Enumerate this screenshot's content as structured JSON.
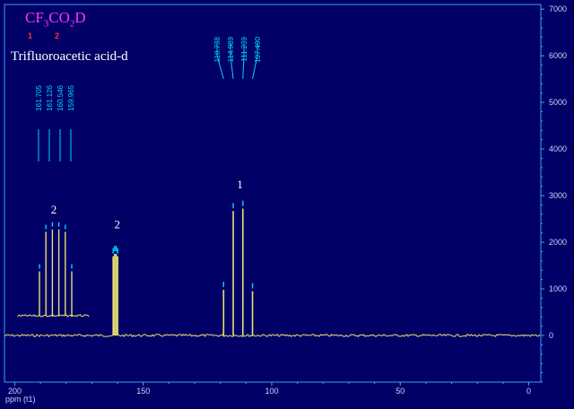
{
  "title": {
    "formula_parts": [
      "CF",
      "3",
      "CO",
      "2",
      "D"
    ],
    "atom_labels": [
      "1",
      "2"
    ],
    "compound_name": "Trifluoroacetic acid-d"
  },
  "colors": {
    "background": "#000066",
    "plot_border": "#3aa0ff",
    "tick_text": "#c8d2ff",
    "spectrum": "#e8e070",
    "formula": "#ff33ff",
    "atom_label": "#ff3333",
    "annotation": "#00d4ff",
    "label_text": "#ffffff"
  },
  "chart_data": {
    "type": "line",
    "xlabel": "ppm (t1)",
    "x_reversed": true,
    "xlim": [
      204,
      -4.7
    ],
    "ylim": [
      -1000,
      7100
    ],
    "x_ticks": [
      200,
      150,
      100,
      50,
      0
    ],
    "y_ticks": [
      0,
      1000,
      2000,
      3000,
      4000,
      5000,
      6000,
      7000
    ],
    "peaks": [
      {
        "ppm": 161.705,
        "height": 1700
      },
      {
        "ppm": 161.126,
        "height": 1750
      },
      {
        "ppm": 160.546,
        "height": 1750
      },
      {
        "ppm": 159.965,
        "height": 1700
      },
      {
        "ppm": 118.738,
        "height": 980
      },
      {
        "ppm": 114.989,
        "height": 2670
      },
      {
        "ppm": 111.239,
        "height": 2720
      },
      {
        "ppm": 107.49,
        "height": 950
      }
    ],
    "peak_groups": [
      {
        "label": "2",
        "ppm": 160.8,
        "height": 2400
      },
      {
        "label": "1",
        "ppm": 113.1,
        "height": 3250
      }
    ],
    "peak_annotations": [
      {
        "values": [
          "161.705",
          "161.126",
          "160.546",
          "159.965"
        ],
        "ppms": [
          161.705,
          161.126,
          160.546,
          159.965
        ]
      },
      {
        "values": [
          "118.738",
          "114.989",
          "111.239",
          "107.490"
        ],
        "ppms": [
          118.738,
          114.989,
          111.239,
          107.49
        ]
      }
    ],
    "inset": {
      "group_label": "2",
      "peak_heights": [
        900,
        1700,
        1750,
        1750,
        1700,
        900
      ],
      "baseline": 300
    }
  }
}
